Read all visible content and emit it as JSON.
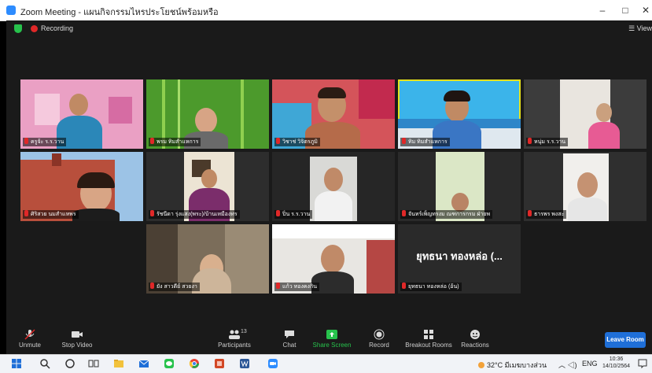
{
  "window": {
    "title": "Zoom Meeting - แผนกิจกรรมไหรประโยชน์พร้อมหรือ",
    "minimize": "–",
    "maximize": "□",
    "close": "✕"
  },
  "topbar": {
    "recording_label": "Recording",
    "view_label": "View"
  },
  "tiles": [
    {
      "name": "ครูจ้ะ ร.ร.วาน"
    },
    {
      "name": "พรม ทิมสำแหการ"
    },
    {
      "name": "วิชาช่ วิจิตรภูมิ"
    },
    {
      "name": "ทิม ทิมสำแหการ"
    },
    {
      "name": "หนุ่ม ร.ร.วาน"
    },
    {
      "name": "ศิริสวย นมสำแหพร"
    },
    {
      "name": "รัชนีดา รุ่งแสง(พระ)/บ้านเหมืองทร"
    },
    {
      "name": "ปิ่น ร.ร.วาน"
    },
    {
      "name": "จันทร์เพ็ญทรงม ณฑการกรม ฝ่ายพ"
    },
    {
      "name": "ธารพร พงสะ"
    },
    {
      "name": "ยัง สาวดีย์ สวยงา"
    },
    {
      "name": "แก้ว ทองคงกิน"
    },
    {
      "name": "ยุทธนา ทองหล่อ (อ้น)",
      "big": "ยุทธนา ทองหล่อ (..."
    }
  ],
  "toolbar": {
    "unmute": "Unmute",
    "stop_video": "Stop Video",
    "participants": "Participants",
    "participants_count": "13",
    "chat": "Chat",
    "share_screen": "Share Screen",
    "record": "Record",
    "breakout": "Breakout Rooms",
    "reactions": "Reactions",
    "leave": "Leave Room"
  },
  "taskbar": {
    "weather": "32°C มีเมฆบางส่วน",
    "lang": "ENG",
    "time": "10:36",
    "date": "14/10/2564"
  },
  "colors": {
    "accent": "#1f6fd8",
    "record": "#e02828",
    "active_speaker": "#e6e21c",
    "share": "#27c24c"
  }
}
